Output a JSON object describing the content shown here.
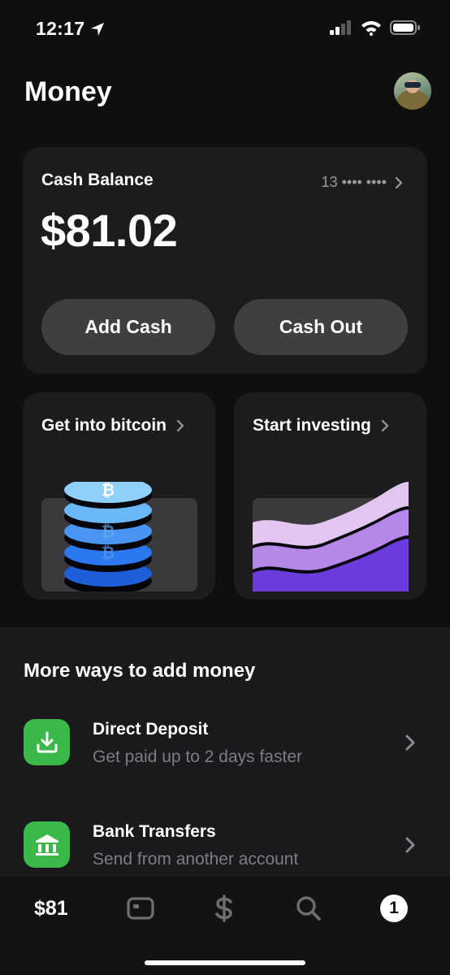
{
  "status_bar": {
    "time": "12:17"
  },
  "header": {
    "title": "Money"
  },
  "balance_card": {
    "label": "Cash Balance",
    "account": "13 •••• ••••",
    "amount": "$81.02",
    "add_cash": "Add Cash",
    "cash_out": "Cash Out"
  },
  "promos": {
    "bitcoin": "Get into bitcoin",
    "investing": "Start investing"
  },
  "more_ways": {
    "title": "More ways to add money",
    "items": [
      {
        "name": "Direct Deposit",
        "description": "Get paid up to 2 days faster",
        "icon": "download-tray-icon"
      },
      {
        "name": "Bank Transfers",
        "description": "Send from another account",
        "icon": "bank-icon"
      }
    ]
  },
  "tab_bar": {
    "balance": "$81",
    "badge": "1",
    "icons": [
      "card-icon",
      "dollar-icon",
      "search-icon",
      "activity-icon"
    ]
  },
  "colors": {
    "accent_green": "#3cb84a",
    "background": "#0f0f0f",
    "card": "#1c1c1e"
  }
}
